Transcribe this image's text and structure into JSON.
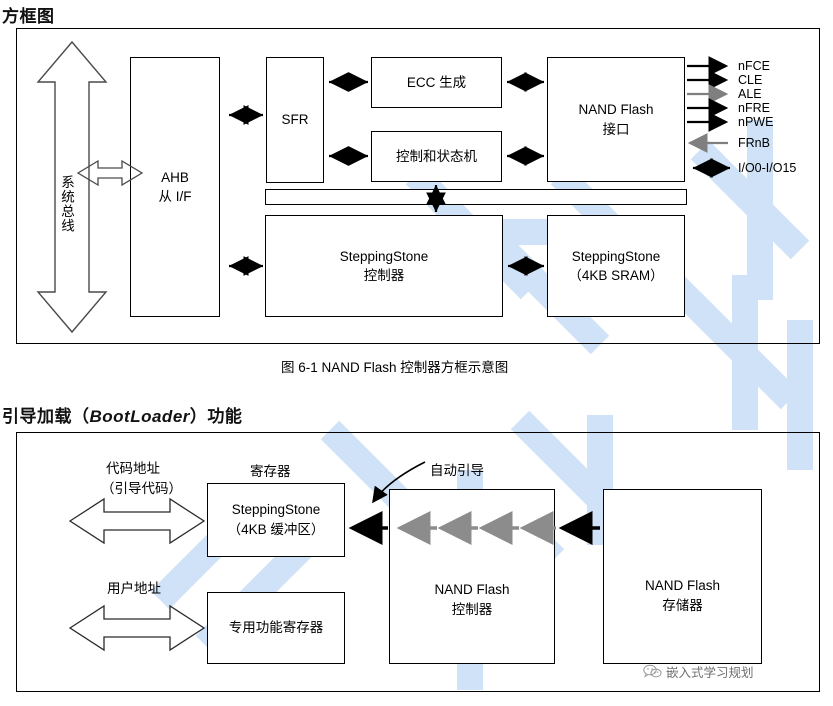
{
  "sections": {
    "block_diagram_heading": "方框图",
    "bootloader_heading_pre": "引导加载（",
    "bootloader_heading_em": "BootLoader",
    "bootloader_heading_post": "）功能"
  },
  "figure1": {
    "caption": "图 6-1 NAND Flash 控制器方框示意图",
    "system_bus_label": "系统总线",
    "blocks": {
      "ahb": {
        "line1": "AHB",
        "line2": "从 I/F"
      },
      "sfr": {
        "line1": "SFR"
      },
      "ecc": {
        "line1": "ECC 生成"
      },
      "ctrl_fsm": {
        "line1": "控制和状态机"
      },
      "nand_if": {
        "line1": "NAND Flash",
        "line2": "接口"
      },
      "ss_ctrl": {
        "line1": "SteppingStone",
        "line2": "控制器"
      },
      "ss_sram": {
        "line1": "SteppingStone",
        "line2": "（4KB SRAM）"
      }
    },
    "signals": [
      {
        "name": "nFCE",
        "dir": "out"
      },
      {
        "name": "CLE",
        "dir": "out"
      },
      {
        "name": "ALE",
        "dir": "out"
      },
      {
        "name": "nFRE",
        "dir": "out"
      },
      {
        "name": "nPWE",
        "dir": "out"
      },
      {
        "name": "FRnB",
        "dir": "in"
      },
      {
        "name": "I/O0-I/O15",
        "dir": "bidir"
      }
    ]
  },
  "figure2": {
    "labels": {
      "code_addr_line1": "代码地址",
      "code_addr_line2": "（引导代码）",
      "register_label": "寄存器",
      "user_addr": "用户地址",
      "auto_boot": "自动引导"
    },
    "blocks": {
      "steppingstone": {
        "line1": "SteppingStone",
        "line2": "（4KB 缓冲区）"
      },
      "sfr_box": {
        "line1": "专用功能寄存器"
      },
      "nand_ctrl": {
        "line1": "NAND Flash",
        "line2": "控制器"
      },
      "nand_mem": {
        "line1": "NAND Flash",
        "line2": "存储器"
      }
    }
  },
  "watermark": {
    "text": "IHuaanl",
    "color": "#cfe2f7",
    "logo_text": "嵌入式学习规划",
    "logo_icon": "wechat-icon"
  },
  "colors": {
    "ink": "#000000",
    "gray_arrow": "#7f7f7f",
    "watermark_blue": "#cfe2f7"
  }
}
